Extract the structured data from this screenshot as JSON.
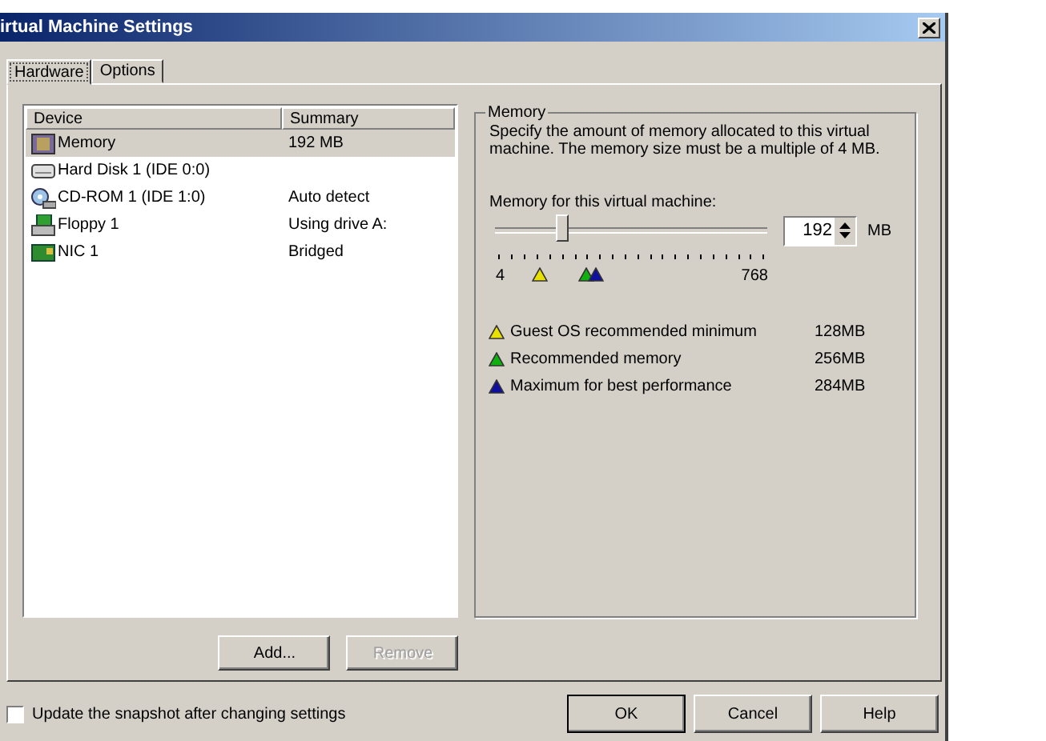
{
  "window": {
    "title": "irtual Machine Settings"
  },
  "tabs": [
    {
      "label": "Hardware",
      "selected": true
    },
    {
      "label": "Options",
      "selected": false
    }
  ],
  "devices": {
    "columns": [
      "Device",
      "Summary"
    ],
    "rows": [
      {
        "kind": "memory",
        "device": "Memory",
        "summary": "192 MB",
        "selected": true
      },
      {
        "kind": "disk",
        "device": "Hard Disk 1 (IDE 0:0)",
        "selected": false
      },
      {
        "kind": "cdrom",
        "device": "CD-ROM 1 (IDE 1:0)",
        "summary": "Auto detect",
        "selected": false
      },
      {
        "kind": "floppy",
        "device": "Floppy 1",
        "summary": "Using drive A:",
        "selected": false
      },
      {
        "kind": "nic",
        "device": "NIC 1",
        "summary": "Bridged",
        "selected": false
      }
    ]
  },
  "list_buttons": [
    {
      "label": "Add...",
      "disabled": false
    },
    {
      "label": "Remove",
      "disabled": true
    }
  ],
  "memory": {
    "title": "Memory",
    "description": "Specify the amount of memory allocated to this virtual machine. The memory size must be a multiple of 4 MB.",
    "field_label": "Memory for this virtual machine:",
    "level": 0.246,
    "value": "192",
    "unit": "MB",
    "scale_min": "4",
    "scale_max": "768",
    "legend": [
      {
        "label": "Guest OS recommended minimum",
        "amount": "128MB",
        "color": "#e8e000"
      },
      {
        "label": "Recommended memory",
        "amount": "256MB",
        "color": "#10b010"
      },
      {
        "label": "Maximum for best performance",
        "amount": "284MB",
        "color": "#1010a0"
      }
    ]
  },
  "snapshot": {
    "label": "Update the snapshot after changing settings",
    "checked": false
  },
  "buttons": [
    {
      "label": "OK",
      "default": true
    },
    {
      "label": "Cancel",
      "default": false
    },
    {
      "label": "Help",
      "default": false
    }
  ]
}
